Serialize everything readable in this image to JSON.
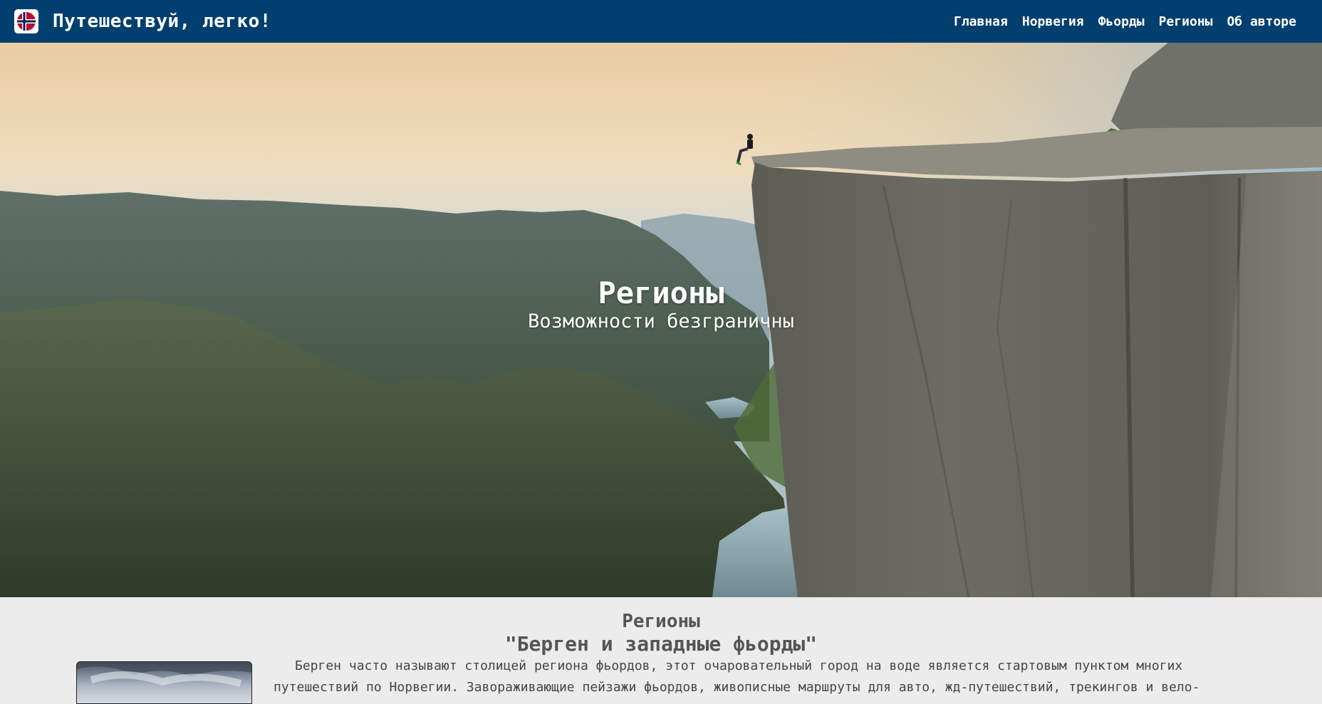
{
  "header": {
    "brand_title": "Путешествуй, легко!",
    "logo_icon": "norway-flag-icon",
    "nav": [
      "Главная",
      "Норвегия",
      "Фьорды",
      "Регионы",
      "Об авторе"
    ]
  },
  "hero": {
    "title": "Регионы",
    "subtitle": "Возможности безграничны"
  },
  "section": {
    "title": "Регионы",
    "subtitle": "\"Берген и западные фьорды\"",
    "paragraph": "Берген часто называют столицей региона фьордов, этот очаровательный город на воде является стартовым пунктом многих путешествий по Норвегии. Завораживающие пейзажи фьордов, живописные маршруты для авто, жд-путешествий, трекингов и вело-"
  },
  "colors": {
    "navbar": "#003f6e",
    "page_background": "#ececec",
    "text_dark": "#555555"
  }
}
